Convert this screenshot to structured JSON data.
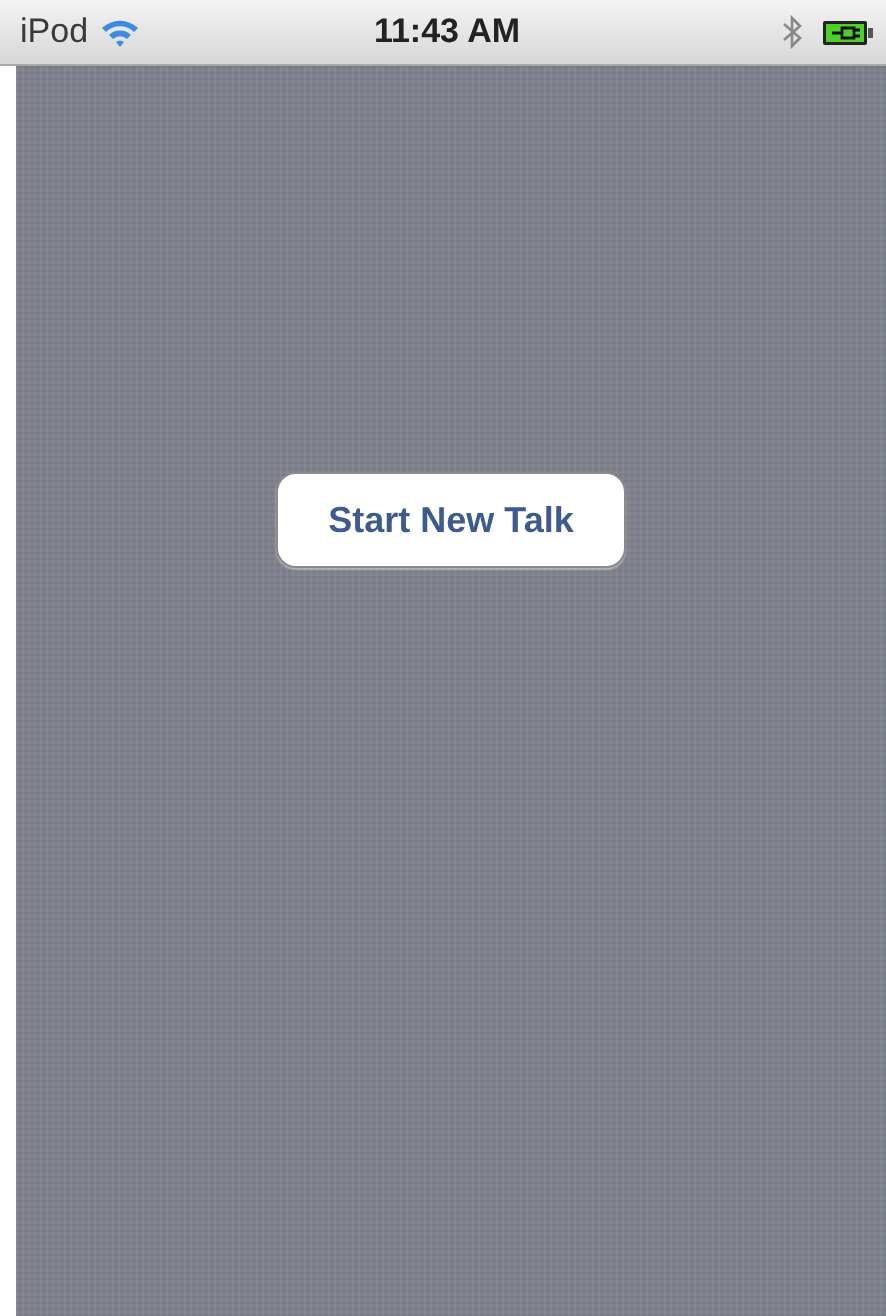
{
  "status_bar": {
    "carrier": "iPod",
    "time": "11:43 AM"
  },
  "main": {
    "button": "Start New Talk"
  }
}
